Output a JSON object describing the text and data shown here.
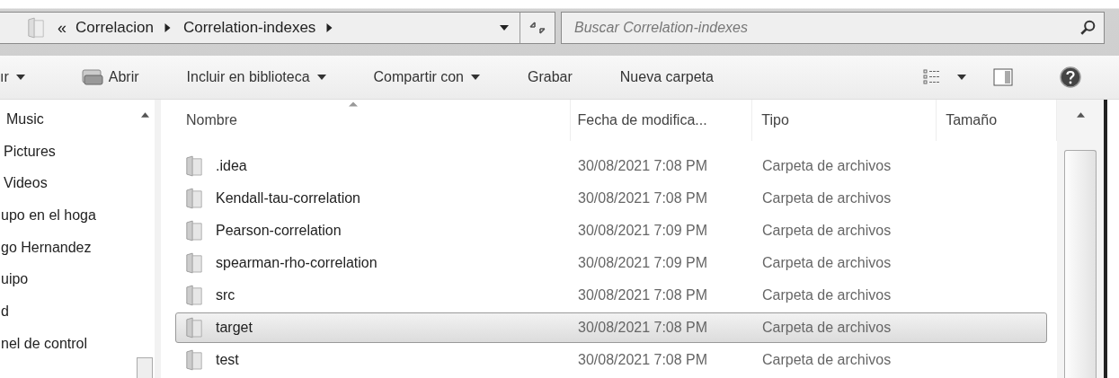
{
  "address_bar": {
    "overflow": "«",
    "path": [
      "Correlacion",
      "Correlation-indexes"
    ]
  },
  "search": {
    "placeholder": "Buscar Correlation-indexes"
  },
  "toolbar": [
    {
      "label": "ır",
      "kind": "menu"
    },
    {
      "label": "Abrir",
      "kind": "open"
    },
    {
      "label": "Incluir en biblioteca",
      "kind": "menu"
    },
    {
      "label": "Compartir con",
      "kind": "menu"
    },
    {
      "label": "Grabar",
      "kind": "button"
    },
    {
      "label": "Nueva carpeta",
      "kind": "button"
    }
  ],
  "sidebar": {
    "items": [
      "Music",
      "Pictures",
      "Videos",
      "upo en el hoga",
      "go Hernandez",
      "uipo",
      "d",
      "nel de control"
    ]
  },
  "table": {
    "columns": [
      {
        "label": "Nombre",
        "sorted": true
      },
      {
        "label": "Fecha de modifica...",
        "sorted": false
      },
      {
        "label": "Tipo",
        "sorted": false
      },
      {
        "label": "Tamaño",
        "sorted": false
      }
    ],
    "rows": [
      {
        "name": ".idea",
        "date": "30/08/2021 7:08 PM",
        "type": "Carpeta de archivos",
        "selected": false
      },
      {
        "name": "Kendall-tau-correlation",
        "date": "30/08/2021 7:08 PM",
        "type": "Carpeta de archivos",
        "selected": false
      },
      {
        "name": "Pearson-correlation",
        "date": "30/08/2021 7:09 PM",
        "type": "Carpeta de archivos",
        "selected": false
      },
      {
        "name": "spearman-rho-correlation",
        "date": "30/08/2021 7:09 PM",
        "type": "Carpeta de archivos",
        "selected": false
      },
      {
        "name": "src",
        "date": "30/08/2021 7:08 PM",
        "type": "Carpeta de archivos",
        "selected": false
      },
      {
        "name": "target",
        "date": "30/08/2021 7:08 PM",
        "type": "Carpeta de archivos",
        "selected": true
      },
      {
        "name": "test",
        "date": "30/08/2021 7:08 PM",
        "type": "Carpeta de archivos",
        "selected": false
      }
    ]
  }
}
